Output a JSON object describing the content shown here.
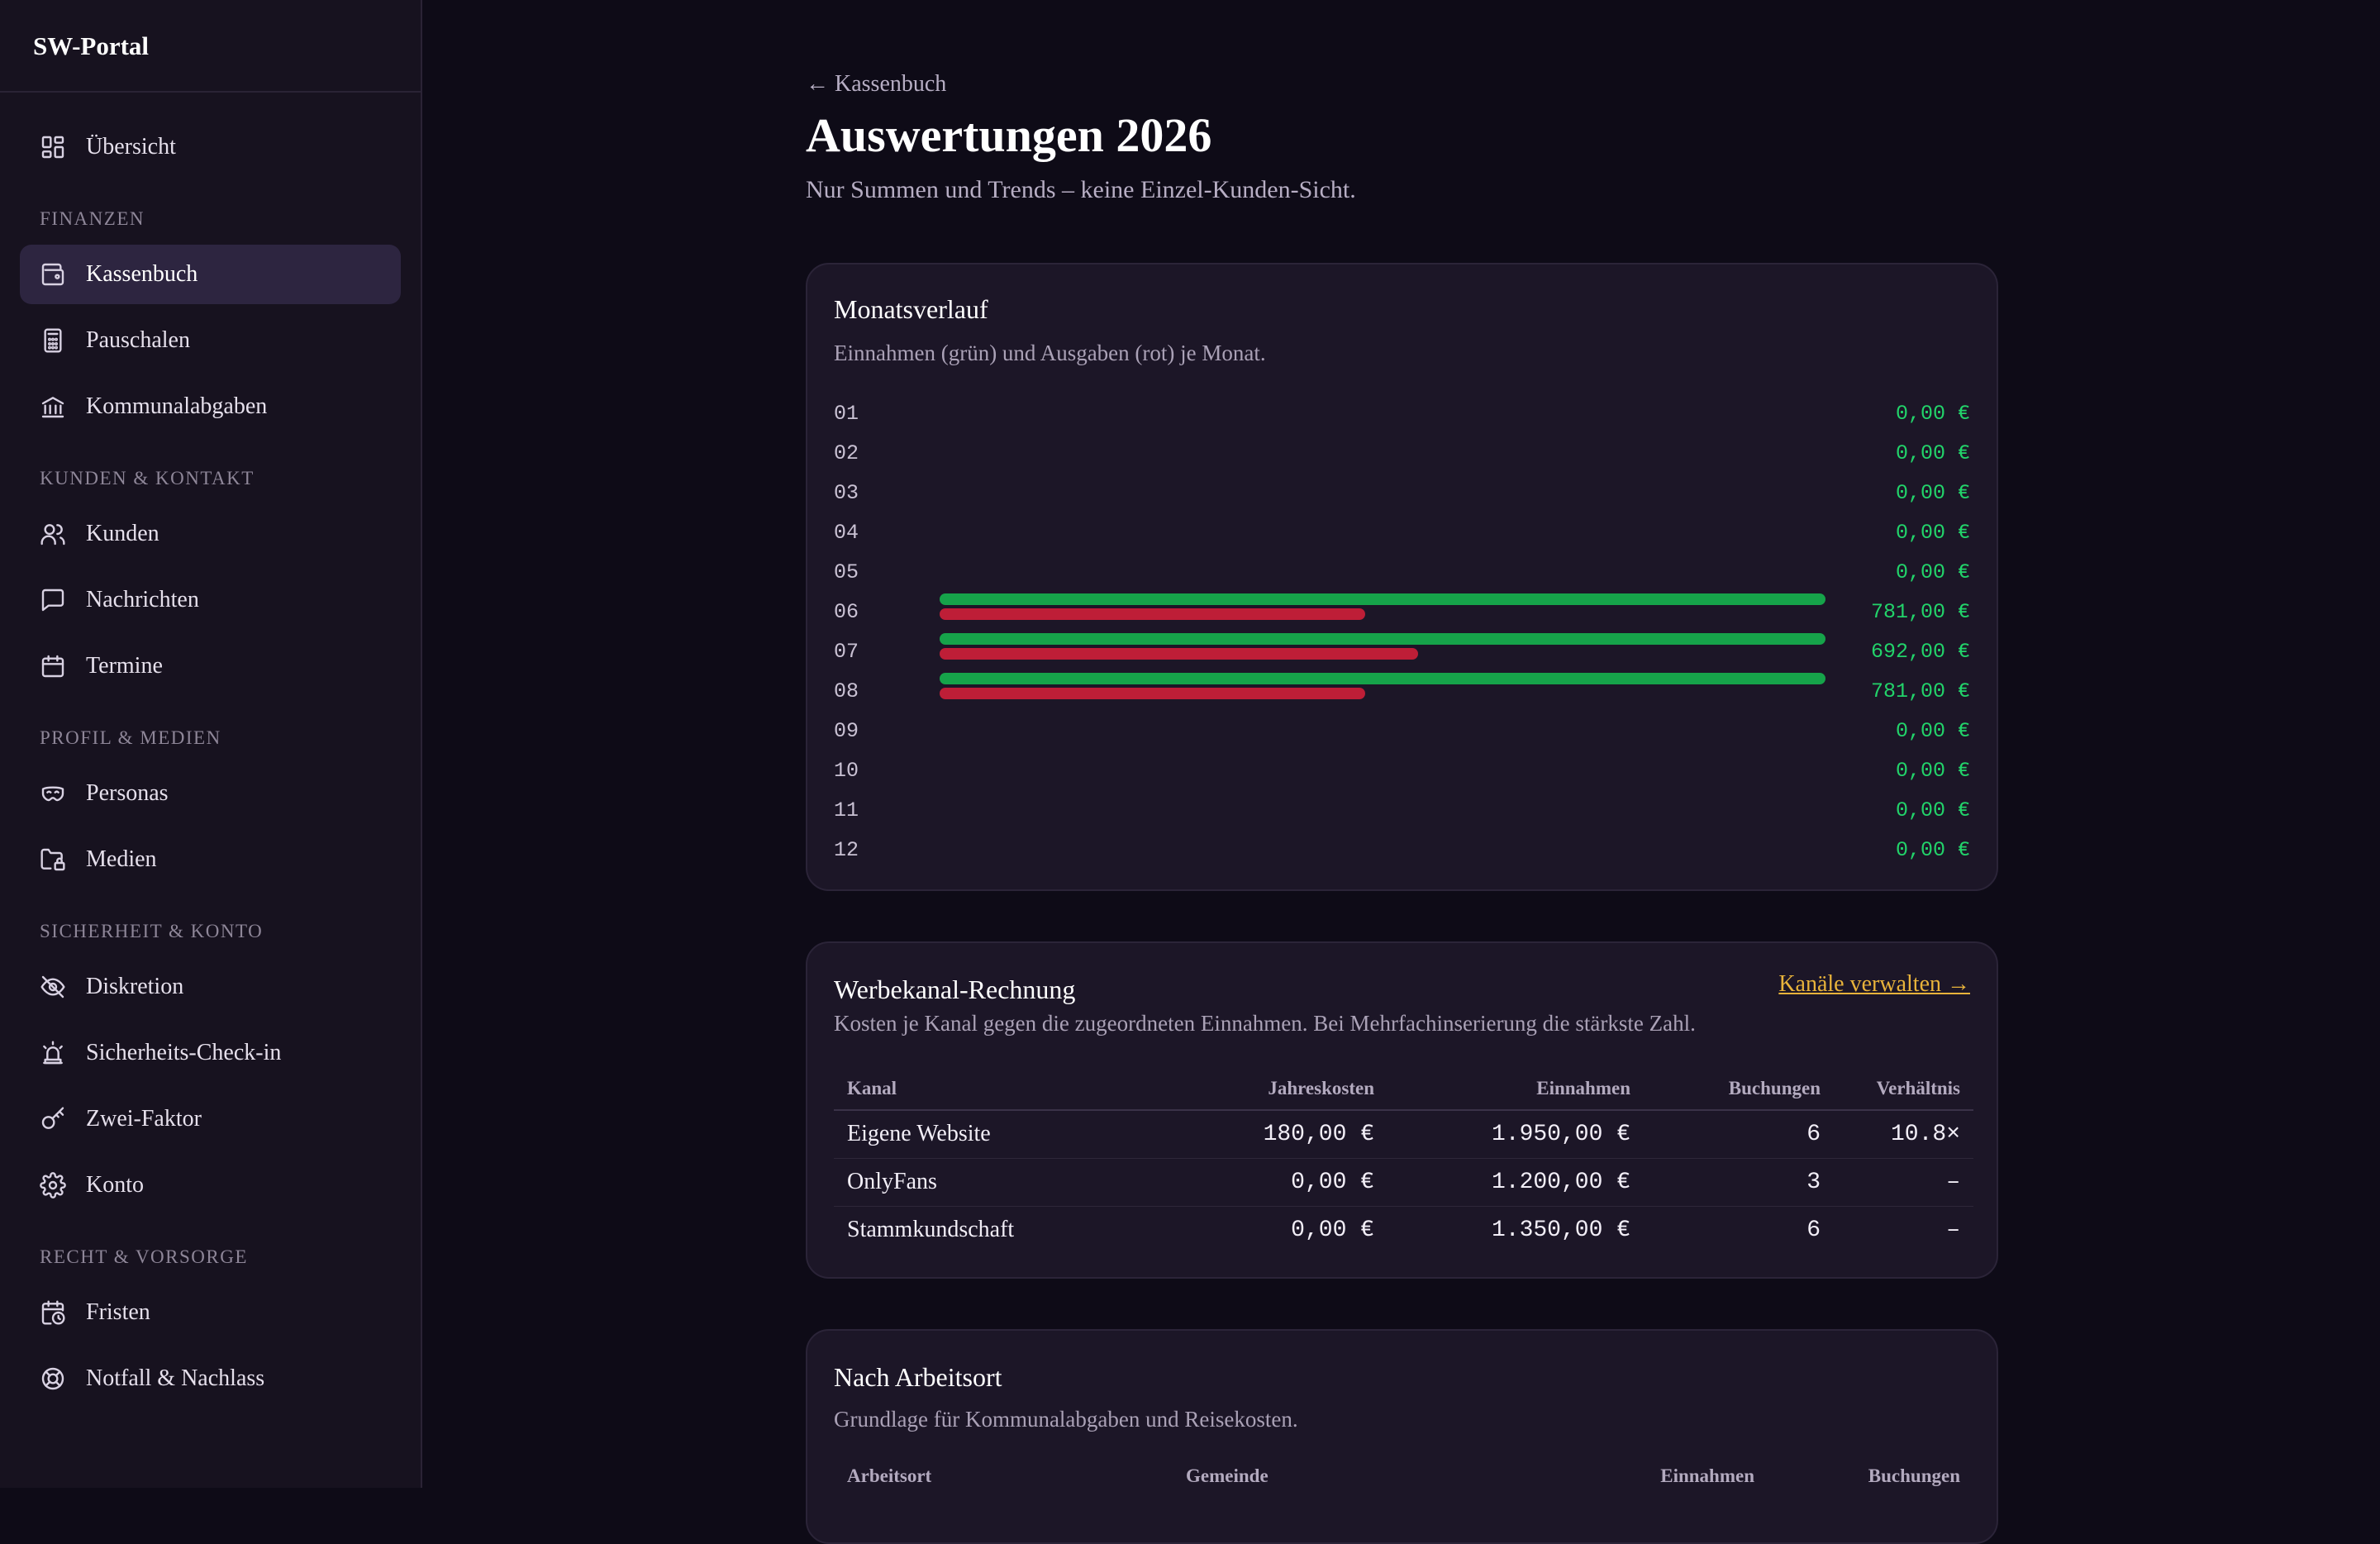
{
  "brand": "SW-Portal",
  "nav": {
    "top": [
      {
        "label": "Übersicht",
        "icon": "dashboard-icon"
      }
    ],
    "sections": [
      {
        "label": "FINANZEN",
        "items": [
          {
            "label": "Kassenbuch",
            "icon": "wallet-icon",
            "active": true
          },
          {
            "label": "Pauschalen",
            "icon": "calculator-icon"
          },
          {
            "label": "Kommunalabgaben",
            "icon": "bank-icon"
          }
        ]
      },
      {
        "label": "KUNDEN & KONTAKT",
        "items": [
          {
            "label": "Kunden",
            "icon": "users-icon"
          },
          {
            "label": "Nachrichten",
            "icon": "message-icon"
          },
          {
            "label": "Termine",
            "icon": "calendar-icon"
          }
        ]
      },
      {
        "label": "PROFIL & MEDIEN",
        "items": [
          {
            "label": "Personas",
            "icon": "mask-icon"
          },
          {
            "label": "Medien",
            "icon": "folder-lock-icon"
          }
        ]
      },
      {
        "label": "SICHERHEIT & KONTO",
        "items": [
          {
            "label": "Diskretion",
            "icon": "eye-off-icon"
          },
          {
            "label": "Sicherheits-Check-in",
            "icon": "siren-icon"
          },
          {
            "label": "Zwei-Faktor",
            "icon": "key-icon"
          },
          {
            "label": "Konto",
            "icon": "gear-icon"
          }
        ]
      },
      {
        "label": "RECHT & VORSORGE",
        "items": [
          {
            "label": "Fristen",
            "icon": "calendar-clock-icon"
          },
          {
            "label": "Notfall & Nachlass",
            "icon": "lifebuoy-icon"
          }
        ]
      }
    ]
  },
  "header": {
    "back_label": "← Kassenbuch",
    "title": "Auswertungen 2026",
    "subtitle": "Nur Summen und Trends – keine Einzel-Kunden-Sicht."
  },
  "monthly": {
    "title": "Monatsverlauf",
    "description": "Einnahmen (grün) und Ausgaben (rot) je Monat.",
    "colors": {
      "income": "#16a34a",
      "expense": "#be1e37",
      "value": "#22d36a"
    },
    "rows": [
      {
        "month": "01",
        "income_fraction": 0,
        "expense_fraction": 0,
        "value": "0,00 €"
      },
      {
        "month": "02",
        "income_fraction": 0,
        "expense_fraction": 0,
        "value": "0,00 €"
      },
      {
        "month": "03",
        "income_fraction": 0,
        "expense_fraction": 0,
        "value": "0,00 €"
      },
      {
        "month": "04",
        "income_fraction": 0,
        "expense_fraction": 0,
        "value": "0,00 €"
      },
      {
        "month": "05",
        "income_fraction": 0,
        "expense_fraction": 0,
        "value": "0,00 €"
      },
      {
        "month": "06",
        "income_fraction": 1.0,
        "expense_fraction": 0.48,
        "value": "781,00 €"
      },
      {
        "month": "07",
        "income_fraction": 1.0,
        "expense_fraction": 0.54,
        "value": "692,00 €"
      },
      {
        "month": "08",
        "income_fraction": 1.0,
        "expense_fraction": 0.48,
        "value": "781,00 €"
      },
      {
        "month": "09",
        "income_fraction": 0,
        "expense_fraction": 0,
        "value": "0,00 €"
      },
      {
        "month": "10",
        "income_fraction": 0,
        "expense_fraction": 0,
        "value": "0,00 €"
      },
      {
        "month": "11",
        "income_fraction": 0,
        "expense_fraction": 0,
        "value": "0,00 €"
      },
      {
        "month": "12",
        "income_fraction": 0,
        "expense_fraction": 0,
        "value": "0,00 €"
      }
    ]
  },
  "channels": {
    "title": "Werbekanal-Rechnung",
    "link_label": "Kanäle verwalten →",
    "description": "Kosten je Kanal gegen die zugeordneten Einnahmen. Bei Mehrfachinserierung die stärkste Zahl.",
    "headers": [
      "Kanal",
      "Jahreskosten",
      "Einnahmen",
      "Buchungen",
      "Verhältnis"
    ],
    "rows": [
      [
        "Eigene Website",
        "180,00 €",
        "1.950,00 €",
        "6",
        "10.8×"
      ],
      [
        "OnlyFans",
        "0,00 €",
        "1.200,00 €",
        "3",
        "–"
      ],
      [
        "Stammkundschaft",
        "0,00 €",
        "1.350,00 €",
        "6",
        "–"
      ]
    ]
  },
  "workplace": {
    "title": "Nach Arbeitsort",
    "description": "Grundlage für Kommunalabgaben und Reisekosten.",
    "headers": [
      "Arbeitsort",
      "Gemeinde",
      "Einnahmen",
      "Buchungen"
    ]
  }
}
